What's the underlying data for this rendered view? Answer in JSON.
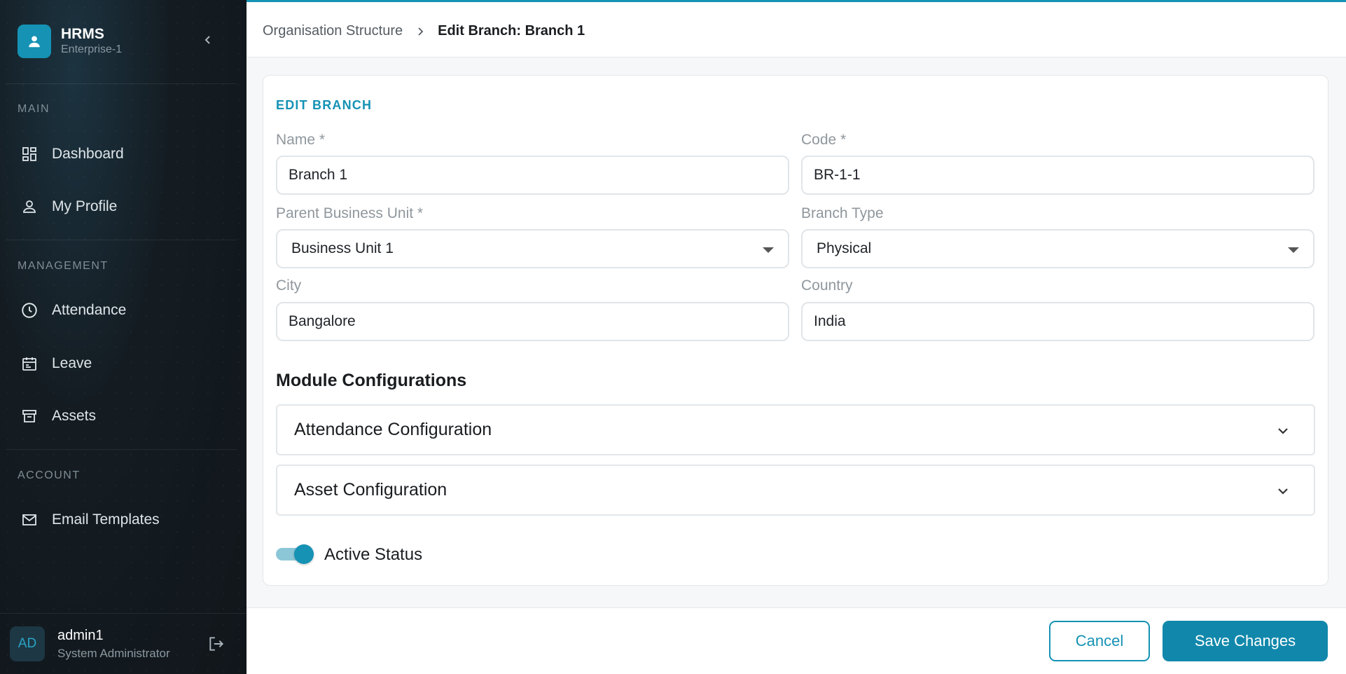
{
  "brand": {
    "title": "HRMS",
    "subtitle": "Enterprise-1"
  },
  "sidebar": {
    "sections": [
      {
        "label": "MAIN"
      },
      {
        "label": "MANAGEMENT"
      },
      {
        "label": "ACCOUNT"
      }
    ],
    "items": [
      {
        "label": "Dashboard",
        "icon": "dashboard-icon"
      },
      {
        "label": "My Profile",
        "icon": "person-icon"
      },
      {
        "label": "Attendance",
        "icon": "clock-icon"
      },
      {
        "label": "Leave",
        "icon": "calendar-icon"
      },
      {
        "label": "Assets",
        "icon": "archive-icon"
      },
      {
        "label": "Email Templates",
        "icon": "mail-icon"
      }
    ]
  },
  "user": {
    "initials": "AD",
    "name": "admin1",
    "role": "System Administrator"
  },
  "breadcrumb": {
    "parent": "Organisation Structure",
    "current": "Edit Branch: Branch 1"
  },
  "form": {
    "title": "EDIT BRANCH",
    "name": {
      "label": "Name *",
      "value": "Branch 1"
    },
    "code": {
      "label": "Code *",
      "value": "BR-1-1"
    },
    "parent_bu": {
      "label": "Parent Business Unit *",
      "value": "Business Unit 1"
    },
    "branch_type": {
      "label": "Branch Type",
      "value": "Physical"
    },
    "city": {
      "label": "City",
      "value": "Bangalore"
    },
    "country": {
      "label": "Country",
      "value": "India"
    }
  },
  "modules": {
    "heading": "Module Configurations",
    "items": [
      {
        "label": "Attendance Configuration"
      },
      {
        "label": "Asset Configuration"
      }
    ]
  },
  "status": {
    "label": "Active Status",
    "active": true
  },
  "actions": {
    "cancel": "Cancel",
    "save": "Save Changes"
  },
  "colors": {
    "accent": "#1592b4",
    "sidebar_bg": "#141c22"
  }
}
